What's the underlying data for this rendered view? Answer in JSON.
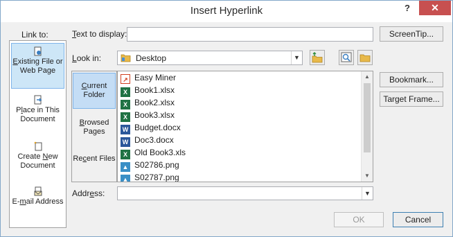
{
  "window": {
    "title": "Insert Hyperlink",
    "help_glyph": "?",
    "close_glyph": "✕"
  },
  "link_to": {
    "label": "Link to:",
    "items": [
      {
        "pre": "",
        "acc": "E",
        "post": "xisting File or Web Page",
        "icon": "existing-file-icon",
        "selected": true
      },
      {
        "pre": "P",
        "acc": "l",
        "post": "ace in This Document",
        "icon": "place-in-document-icon",
        "selected": false
      },
      {
        "pre": "Create ",
        "acc": "N",
        "post": "ew Document",
        "icon": "new-document-icon",
        "selected": false
      },
      {
        "pre": "E-",
        "acc": "m",
        "post": "ail Address",
        "icon": "email-icon",
        "selected": false
      }
    ]
  },
  "text_to_display": {
    "label_acc": "T",
    "label_rest": "ext to display:",
    "value": ""
  },
  "screentip_button": "ScreenTip...",
  "look_in": {
    "label_acc": "L",
    "label_rest": "ook in:",
    "value": "Desktop",
    "folder_icon": "folder-icon"
  },
  "tabs": [
    {
      "pre": "",
      "acc": "C",
      "post": "urrent Folder",
      "selected": true
    },
    {
      "pre": "",
      "acc": "B",
      "post": "rowsed Pages",
      "selected": false
    },
    {
      "pre": "Re",
      "acc": "c",
      "post": "ent Files",
      "selected": false
    }
  ],
  "files": [
    {
      "name": "Easy Miner",
      "type": "app"
    },
    {
      "name": "Book1.xlsx",
      "type": "excel"
    },
    {
      "name": "Book2.xlsx",
      "type": "excel"
    },
    {
      "name": "Book3.xlsx",
      "type": "excel"
    },
    {
      "name": "Budget.docx",
      "type": "word"
    },
    {
      "name": "Doc3.docx",
      "type": "word"
    },
    {
      "name": "Old Book3.xls",
      "type": "excel"
    },
    {
      "name": "S02786.png",
      "type": "image"
    },
    {
      "name": "S02787.png",
      "type": "image"
    }
  ],
  "right_buttons": {
    "bookmark": "Bookmark...",
    "target_frame": "Target Frame..."
  },
  "address": {
    "label_acc": "e",
    "label_pre": "Addr",
    "label_post": "ss:",
    "value": ""
  },
  "footer": {
    "ok": "OK",
    "cancel": "Cancel",
    "ok_enabled": false
  },
  "colors": {
    "selected_fill": "#cde6f7",
    "selected_border": "#7eb4ea",
    "close_red": "#c75050"
  }
}
